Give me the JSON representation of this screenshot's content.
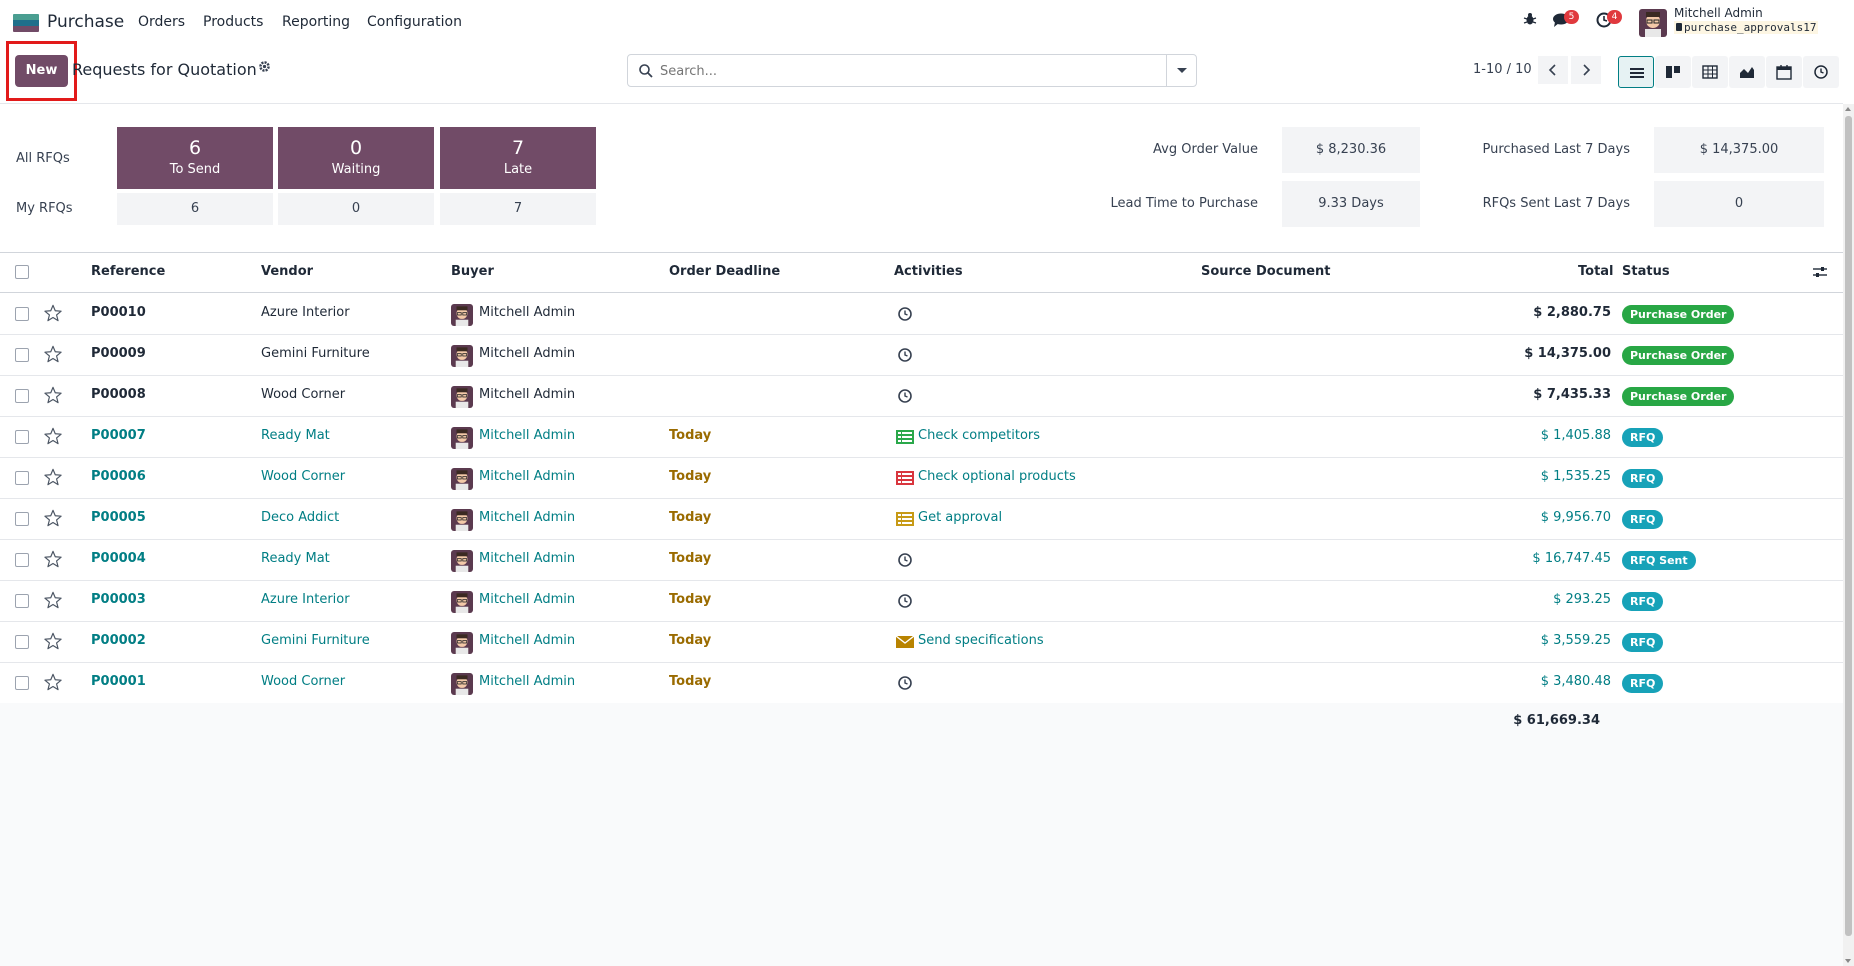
{
  "navbar": {
    "app_name": "Purchase",
    "menu": [
      "Orders",
      "Products",
      "Reporting",
      "Configuration"
    ],
    "messages_count": "5",
    "activities_count": "4",
    "user_name": "Mitchell Admin",
    "db_name": "purchase_approvals17"
  },
  "control": {
    "new_label": "New",
    "title": "Requests for Quotation",
    "search_placeholder": "Search...",
    "pager": "1-10 / 10"
  },
  "dashboard": {
    "all_rfqs_label": "All RFQs",
    "my_rfqs_label": "My RFQs",
    "tiles": [
      {
        "count": "6",
        "label": "To Send",
        "mine": "6"
      },
      {
        "count": "0",
        "label": "Waiting",
        "mine": "0"
      },
      {
        "count": "7",
        "label": "Late",
        "mine": "7"
      }
    ],
    "kpis": {
      "avg_order_label": "Avg Order Value",
      "avg_order_value": "$ 8,230.36",
      "purchased_label": "Purchased Last 7 Days",
      "purchased_value": "$ 14,375.00",
      "lead_time_label": "Lead Time to Purchase",
      "lead_time_value": "9.33  Days",
      "rfqs_sent_label": "RFQs Sent Last 7 Days",
      "rfqs_sent_value": "0"
    }
  },
  "table": {
    "headers": {
      "reference": "Reference",
      "vendor": "Vendor",
      "buyer": "Buyer",
      "deadline": "Order Deadline",
      "activities": "Activities",
      "source": "Source Document",
      "total": "Total",
      "status": "Status"
    },
    "rows": [
      {
        "ref": "P00010",
        "vendor": "Azure Interior",
        "buyer": "Mitchell Admin",
        "deadline": "",
        "activity": "",
        "total": "$ 2,880.75",
        "status": "Purchase Order"
      },
      {
        "ref": "P00009",
        "vendor": "Gemini Furniture",
        "buyer": "Mitchell Admin",
        "deadline": "",
        "activity": "",
        "total": "$ 14,375.00",
        "status": "Purchase Order"
      },
      {
        "ref": "P00008",
        "vendor": "Wood Corner",
        "buyer": "Mitchell Admin",
        "deadline": "",
        "activity": "",
        "total": "$ 7,435.33",
        "status": "Purchase Order"
      },
      {
        "ref": "P00007",
        "vendor": "Ready Mat",
        "buyer": "Mitchell Admin",
        "deadline": "Today",
        "activity": "Check competitors",
        "total": "$ 1,405.88",
        "status": "RFQ"
      },
      {
        "ref": "P00006",
        "vendor": "Wood Corner",
        "buyer": "Mitchell Admin",
        "deadline": "Today",
        "activity": "Check optional products",
        "total": "$ 1,535.25",
        "status": "RFQ"
      },
      {
        "ref": "P00005",
        "vendor": "Deco Addict",
        "buyer": "Mitchell Admin",
        "deadline": "Today",
        "activity": "Get approval",
        "total": "$ 9,956.70",
        "status": "RFQ"
      },
      {
        "ref": "P00004",
        "vendor": "Ready Mat",
        "buyer": "Mitchell Admin",
        "deadline": "Today",
        "activity": "",
        "total": "$ 16,747.45",
        "status": "RFQ Sent"
      },
      {
        "ref": "P00003",
        "vendor": "Azure Interior",
        "buyer": "Mitchell Admin",
        "deadline": "Today",
        "activity": "",
        "total": "$ 293.25",
        "status": "RFQ"
      },
      {
        "ref": "P00002",
        "vendor": "Gemini Furniture",
        "buyer": "Mitchell Admin",
        "deadline": "Today",
        "activity": "Send specifications",
        "total": "$ 3,559.25",
        "status": "RFQ"
      },
      {
        "ref": "P00001",
        "vendor": "Wood Corner",
        "buyer": "Mitchell Admin",
        "deadline": "Today",
        "activity": "",
        "total": "$ 3,480.48",
        "status": "RFQ"
      }
    ],
    "grand_total": "$ 61,669.34"
  },
  "colors": {
    "brand": "#714b67",
    "link": "#017e84",
    "purchase_order": "#28a745",
    "rfq": "#17a2b8",
    "today": "#9a6b00"
  }
}
